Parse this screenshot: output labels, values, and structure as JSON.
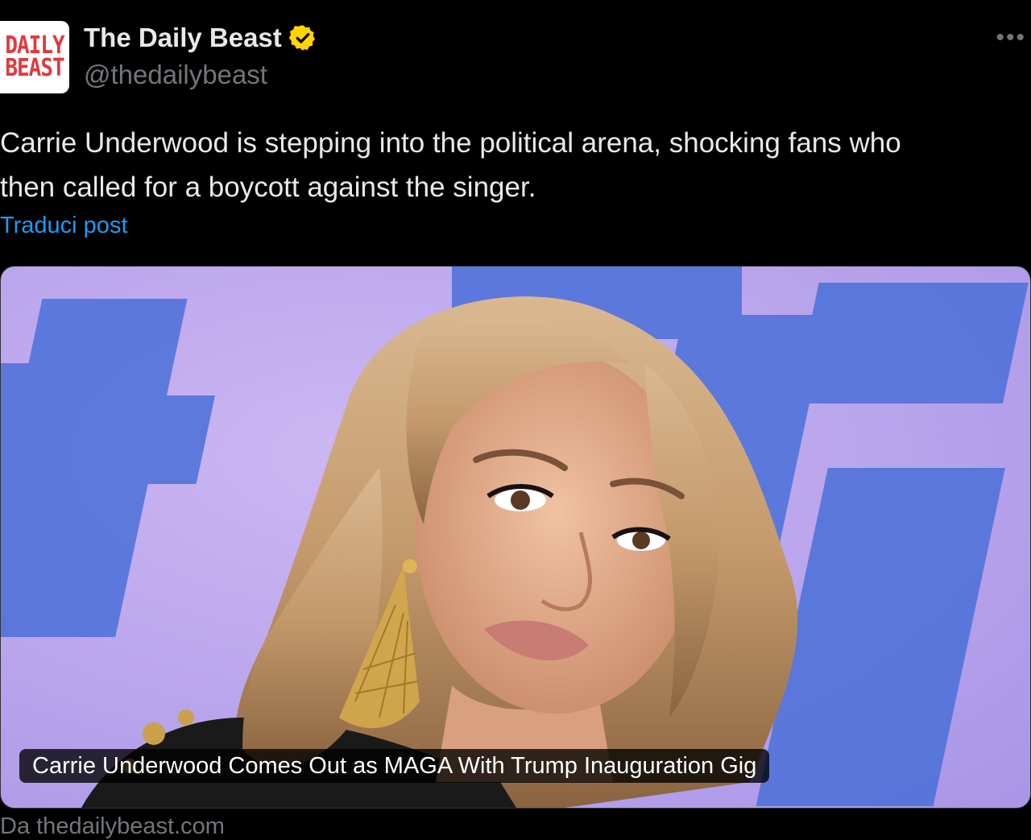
{
  "author": {
    "avatar_lines": [
      "DAILY",
      "BEAST"
    ],
    "display_name": "The Daily Beast",
    "handle": "@thedailybeast",
    "verified": true,
    "verified_color": "#ffd400"
  },
  "more_icon": "more-horizontal-icon",
  "post": {
    "text": "Carrie Underwood is stepping into the political arena, shocking fans who\nthen called for a boycott against the singer.",
    "translate_label": "Traduci post"
  },
  "card": {
    "image_icon": "photo-portrait",
    "caption": "Carrie Underwood Comes Out as MAGA With Trump Inauguration Gig",
    "source": "Da thedailybeast.com"
  },
  "colors": {
    "background": "#000000",
    "text": "#e7e9ea",
    "muted": "#71767b",
    "link": "#1d9bf0",
    "brand_red": "#e03a3e"
  }
}
